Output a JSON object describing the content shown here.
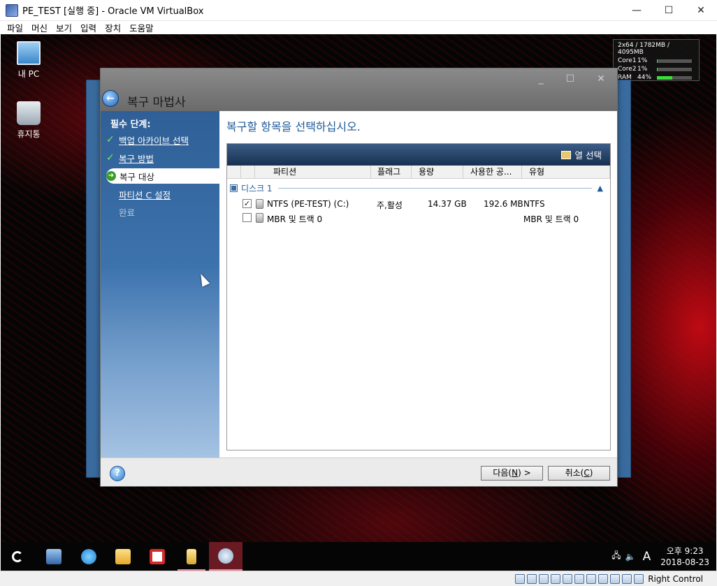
{
  "vbox": {
    "title": "PE_TEST [실행 중] - Oracle VM VirtualBox",
    "menu": [
      "파일",
      "머신",
      "보기",
      "입력",
      "장치",
      "도움말"
    ],
    "minimize_glyph": "—",
    "maximize_glyph": "☐",
    "close_glyph": "✕",
    "host_key": "Right Control"
  },
  "desktop": {
    "icons": [
      {
        "label": "내 PC",
        "icon": "computer-icon"
      },
      {
        "label": "휴지통",
        "icon": "recycle-bin-icon"
      }
    ],
    "perf": {
      "header": "2x64 / 1782MB / 4095MB",
      "rows": [
        {
          "label": "Core1",
          "value": "1%",
          "fraction": 0.01
        },
        {
          "label": "Core2",
          "value": "1%",
          "fraction": 0.01
        },
        {
          "label": "RAM",
          "value": "44%",
          "fraction": 0.44
        }
      ]
    }
  },
  "wizard": {
    "title": "복구 마법사",
    "heading": "복구할 항목을 선택하십시오.",
    "sidebar": {
      "heading": "필수 단계:",
      "steps": [
        {
          "label": "백업 아카이브 선택",
          "state": "done"
        },
        {
          "label": "복구 방법",
          "state": "done"
        },
        {
          "label": "복구 대상",
          "state": "current"
        },
        {
          "label": "파티션 C 설정",
          "state": "pending"
        },
        {
          "label": "완료",
          "state": "disabled"
        }
      ]
    },
    "panel": {
      "column_select_label": "열 선택",
      "columns": [
        "파티션",
        "플래그",
        "용량",
        "사용한 공...",
        "유형"
      ],
      "group_label": "디스크 1",
      "rows": [
        {
          "checked": true,
          "name": "NTFS (PE-TEST) (C:)",
          "flags": "주,활성",
          "capacity": "14.37 GB",
          "used": "192.6 MB",
          "type": "NTFS"
        },
        {
          "checked": false,
          "name": "MBR 및 트랙 0",
          "flags": "",
          "capacity": "",
          "used": "",
          "type": "MBR 및 트랙 0"
        }
      ]
    },
    "buttons": {
      "next_prefix": "다음(",
      "next_key": "N",
      "next_suffix": ") >",
      "cancel_prefix": "취소(",
      "cancel_key": "C",
      "cancel_suffix": ")",
      "help": "?"
    }
  },
  "taskbar": {
    "clock_time": "오후 9:23",
    "clock_date": "2018-08-23",
    "ime": "A"
  }
}
